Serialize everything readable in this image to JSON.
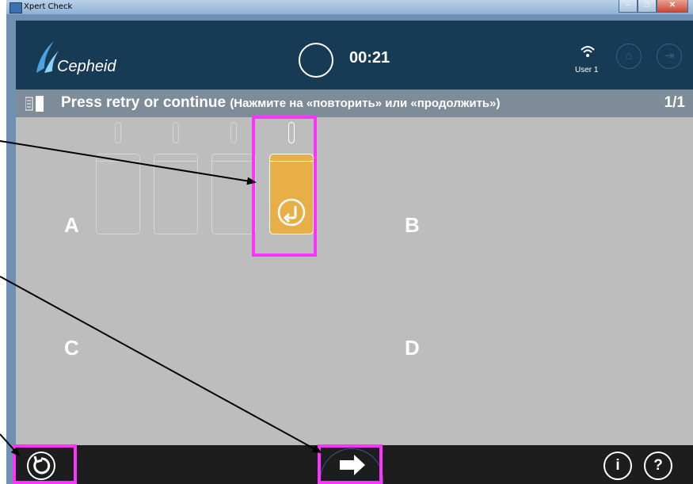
{
  "window": {
    "title": "Xpert Check"
  },
  "header": {
    "logo": "Cepheid",
    "timer": "00:21",
    "user": "User 1",
    "icons": [
      "wifi-icon",
      "home-icon",
      "exit-icon"
    ]
  },
  "instruction": {
    "text": "Press retry or continue",
    "translation": "(Нажмите на «повторить» или «продолжить»)",
    "page": "1/1"
  },
  "bays": {
    "a": "A",
    "b": "B",
    "c": "C",
    "d": "D"
  },
  "footer": {
    "retry_icon": "retry-icon",
    "next_icon": "arrow-right-icon",
    "info_label": "i",
    "help_label": "?"
  },
  "colors": {
    "header": "#173a55",
    "instruction_bar": "#7d8c98",
    "content": "#bdbdbd",
    "footer": "#1d1d1d",
    "module_active": "#e8af46",
    "highlight": "#ff33ff"
  }
}
